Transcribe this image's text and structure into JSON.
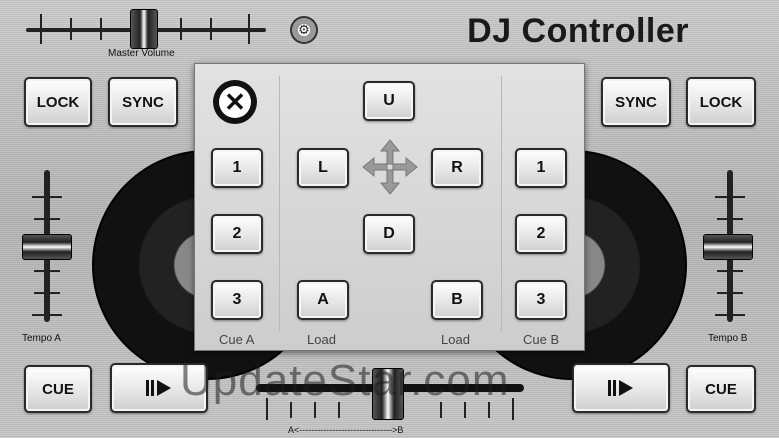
{
  "header": {
    "title": "DJ Controller",
    "master_volume_label": "Master Volume"
  },
  "left": {
    "lock_label": "LOCK",
    "sync_label": "SYNC",
    "tempo_label": "Tempo A",
    "cue_label": "CUE"
  },
  "right": {
    "lock_label": "LOCK",
    "sync_label": "SYNC",
    "tempo_label": "Tempo B",
    "cue_label": "CUE"
  },
  "panel": {
    "cue_a_buttons": [
      "1",
      "2",
      "3"
    ],
    "cue_b_buttons": [
      "1",
      "2",
      "3"
    ],
    "up_label": "U",
    "left_label": "L",
    "right_label": "R",
    "down_label": "D",
    "load_a_label": "A",
    "load_b_label": "B",
    "cue_a_caption": "Cue A",
    "load_a_caption": "Load",
    "load_b_caption": "Load",
    "cue_b_caption": "Cue B"
  },
  "crossfader": {
    "label": "A<------------------------------->B"
  },
  "watermark": "UpdateStar.com",
  "icons": {
    "settings": "gear-icon",
    "close": "close-icon",
    "move": "move-arrows-icon",
    "play": "play-icon"
  }
}
